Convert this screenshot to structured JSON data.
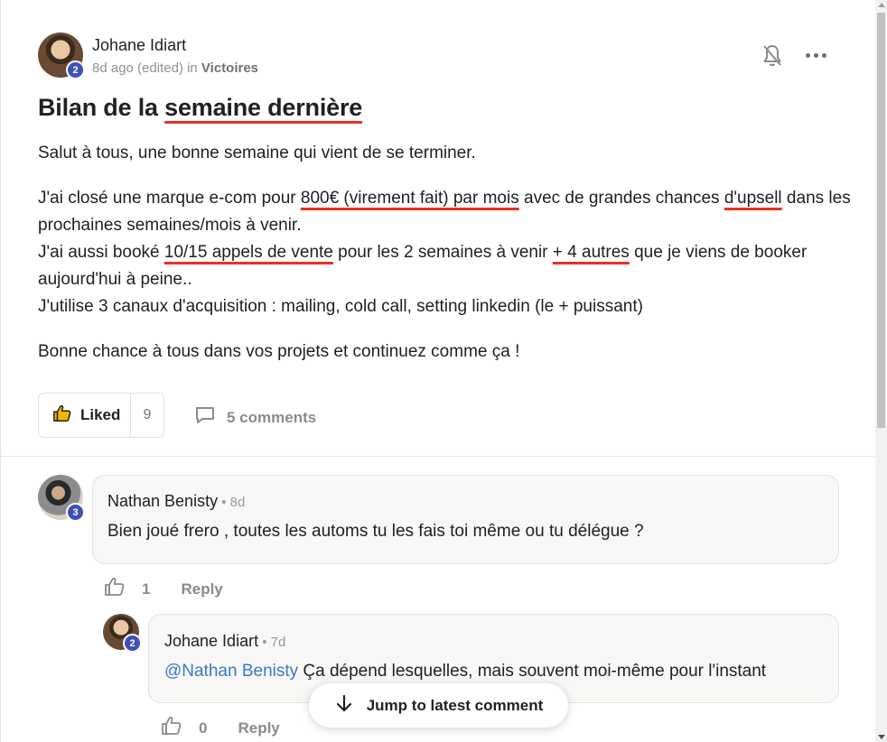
{
  "post": {
    "author": "Johane Idiart",
    "author_level": "2",
    "meta_prefix": "8d ago (edited) in ",
    "group": "Victoires",
    "title_plain": "Bilan de la ",
    "title_underlined": "semaine dernière",
    "paragraphs": {
      "p1": "Salut à tous, une bonne semaine qui vient de se terminer.",
      "p2_a": "J'ai closé une marque e-com pour ",
      "p2_b": "800€ (virement fait) par mois",
      "p2_c": " avec de grandes chances ",
      "p2_d": "d'upsell",
      "p2_e": " dans les prochaines semaines/mois à venir.",
      "p3_a": "J'ai aussi booké ",
      "p3_b": "10/15 appels de vente",
      "p3_c": " pour les 2 semaines à venir ",
      "p3_d": "+ 4 autres",
      "p3_e": " que je viens de booker aujourd'hui à peine..",
      "p4": "J'utilise 3 canaux d'acquisition : mailing, cold call, setting linkedin (le + puissant)",
      "p5": "Bonne chance à tous dans vos projets et continuez comme ça !"
    },
    "like_label": "Liked",
    "like_count": "9",
    "comments_label": "5 comments"
  },
  "comments": [
    {
      "author": "Nathan Benisty",
      "author_level": "3",
      "time": " • 8d",
      "text": "Bien joué frero , toutes les automs tu les fais toi même ou tu délégue ?",
      "likes": "1",
      "reply_label": "Reply"
    },
    {
      "author": "Johane Idiart",
      "author_level": "2",
      "time": " • 7d",
      "mention": "@Nathan Benisty",
      "text": " Ça dépend lesquelles, mais souvent moi-même pour l'instant",
      "likes": "0",
      "reply_label": "Reply"
    }
  ],
  "jump_label": "Jump to latest comment",
  "colors": {
    "accent_underline": "#e8321e",
    "level_badge": "#3f51b5",
    "mention": "#3a78c9"
  },
  "icons": [
    "bell-off-icon",
    "more-icon",
    "thumbs-up-icon",
    "comment-icon",
    "arrow-down-icon"
  ]
}
